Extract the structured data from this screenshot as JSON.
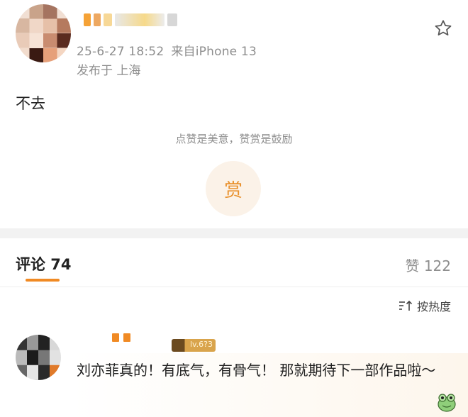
{
  "post": {
    "timestamp": "25-6-27 18:52",
    "source": "来自iPhone 13",
    "location": "发布于 上海",
    "text": "不去",
    "reward_tip": "点赞是美意，赞赏是鼓励",
    "reward_button": "赏"
  },
  "comments_section": {
    "tab_label": "评论 74",
    "likes_label": "赞 122",
    "sort_label": "按热度"
  },
  "comment": {
    "badge": "lv.6?3",
    "text": "刘亦菲真的！有底气，有骨气！ 那就期待下一部作品啦～"
  },
  "icons": {
    "star": "star-outline-icon",
    "sort": "sort-icon"
  },
  "colors": {
    "accent": "#f08a24",
    "muted": "#8e8e8e"
  }
}
